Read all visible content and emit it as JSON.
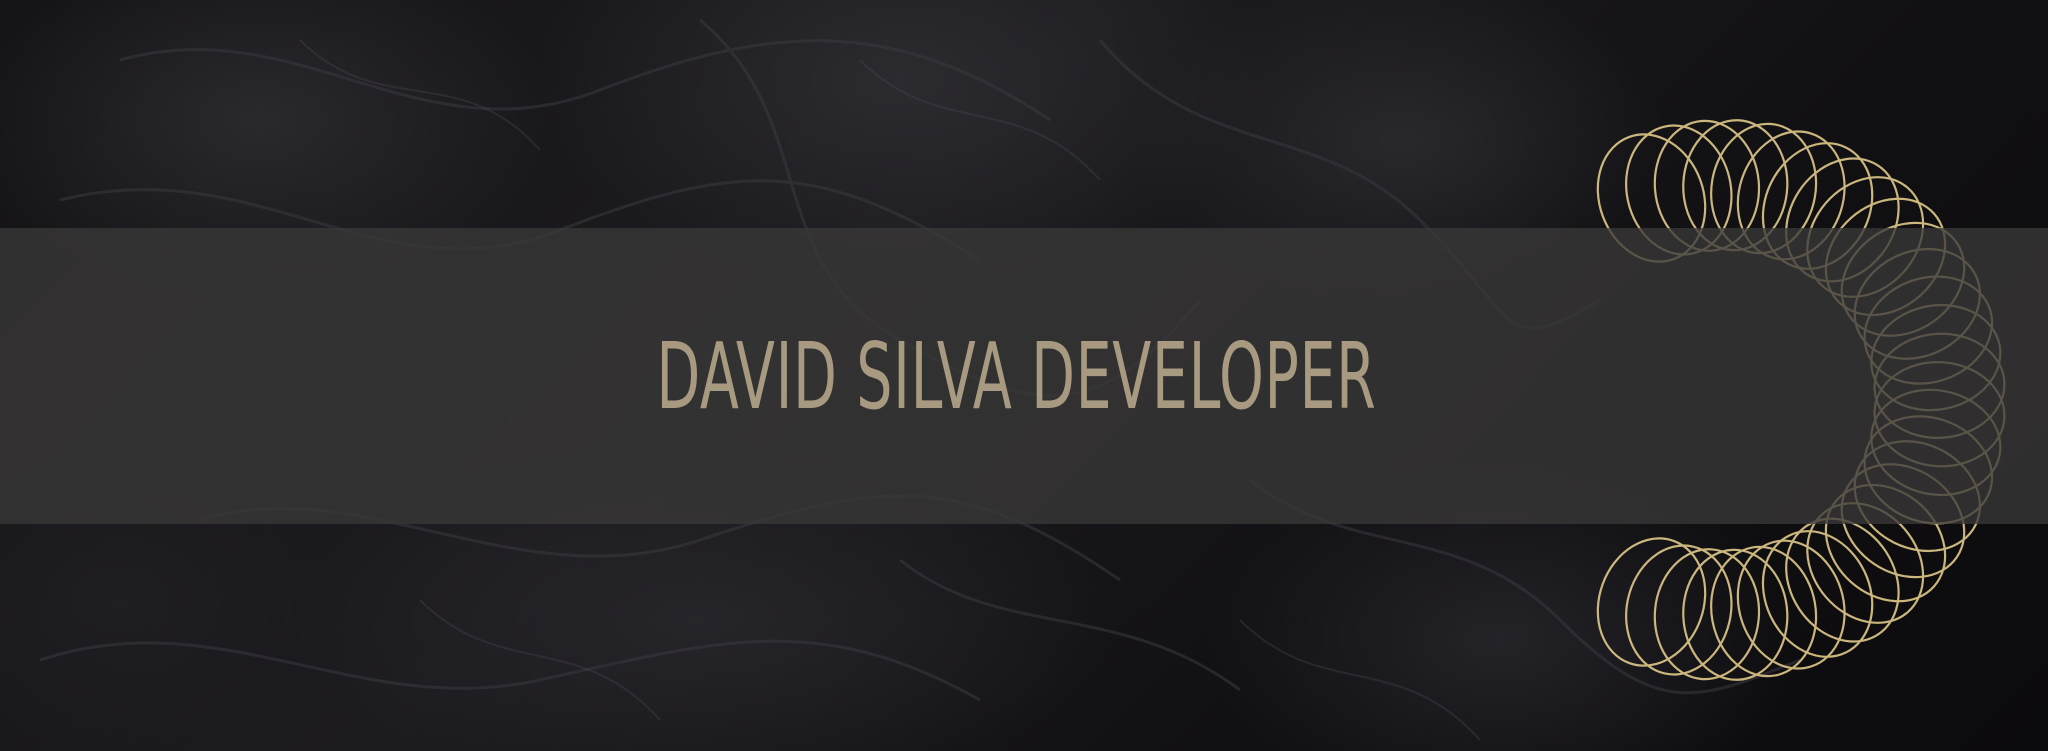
{
  "hero": {
    "title": "DAVID SILVA DEVELOPER"
  },
  "colors": {
    "background": "#0c0b0d",
    "band": "#3a3838",
    "title_text": "#a89a80",
    "spirograph_gold": "#e0c98a"
  },
  "icons": {
    "spirograph": "gold-spirograph-ring"
  }
}
